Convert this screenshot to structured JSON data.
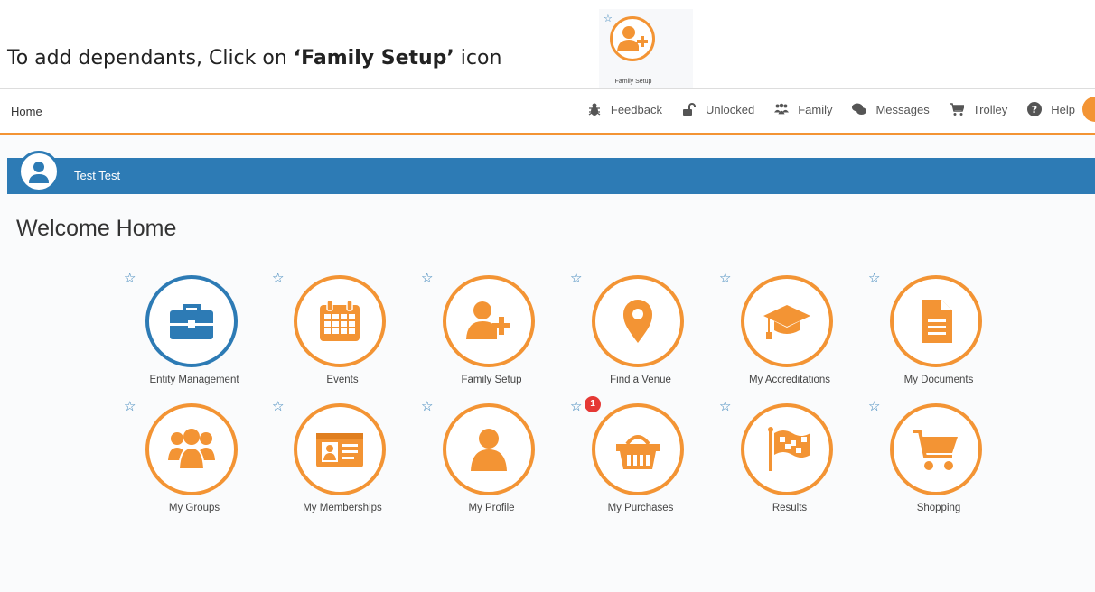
{
  "instruction": {
    "prefix": "To add dependants, Click on ",
    "highlight": "‘Family Setup’",
    "suffix": " icon",
    "callout_caption": "Family Setup"
  },
  "topbar": {
    "home": "Home",
    "nav": [
      {
        "label": "Feedback",
        "icon": "bug-icon"
      },
      {
        "label": "Unlocked",
        "icon": "unlock-icon"
      },
      {
        "label": "Family",
        "icon": "family-icon"
      },
      {
        "label": "Messages",
        "icon": "chat-icon"
      },
      {
        "label": "Trolley",
        "icon": "cart-icon"
      },
      {
        "label": "Help",
        "icon": "help-icon"
      }
    ]
  },
  "user": {
    "name": "Test Test"
  },
  "welcome": "Welcome Home",
  "tiles": [
    {
      "label": "Entity Management",
      "icon": "briefcase-icon"
    },
    {
      "label": "Events",
      "icon": "calendar-icon"
    },
    {
      "label": "Family Setup",
      "icon": "add-user-icon"
    },
    {
      "label": "Find a Venue",
      "icon": "map-pin-icon"
    },
    {
      "label": "My Accreditations",
      "icon": "graduation-cap-icon"
    },
    {
      "label": "My Documents",
      "icon": "document-icon"
    },
    {
      "label": "My Groups",
      "icon": "group-icon"
    },
    {
      "label": "My Memberships",
      "icon": "id-card-icon"
    },
    {
      "label": "My Profile",
      "icon": "user-icon"
    },
    {
      "label": "My Purchases",
      "icon": "basket-icon",
      "badge": "1"
    },
    {
      "label": "Results",
      "icon": "flag-icon"
    },
    {
      "label": "Shopping",
      "icon": "shopping-cart-icon"
    }
  ],
  "colors": {
    "accent": "#f39434",
    "primary": "#2d7bb5",
    "badge": "#e53935"
  }
}
